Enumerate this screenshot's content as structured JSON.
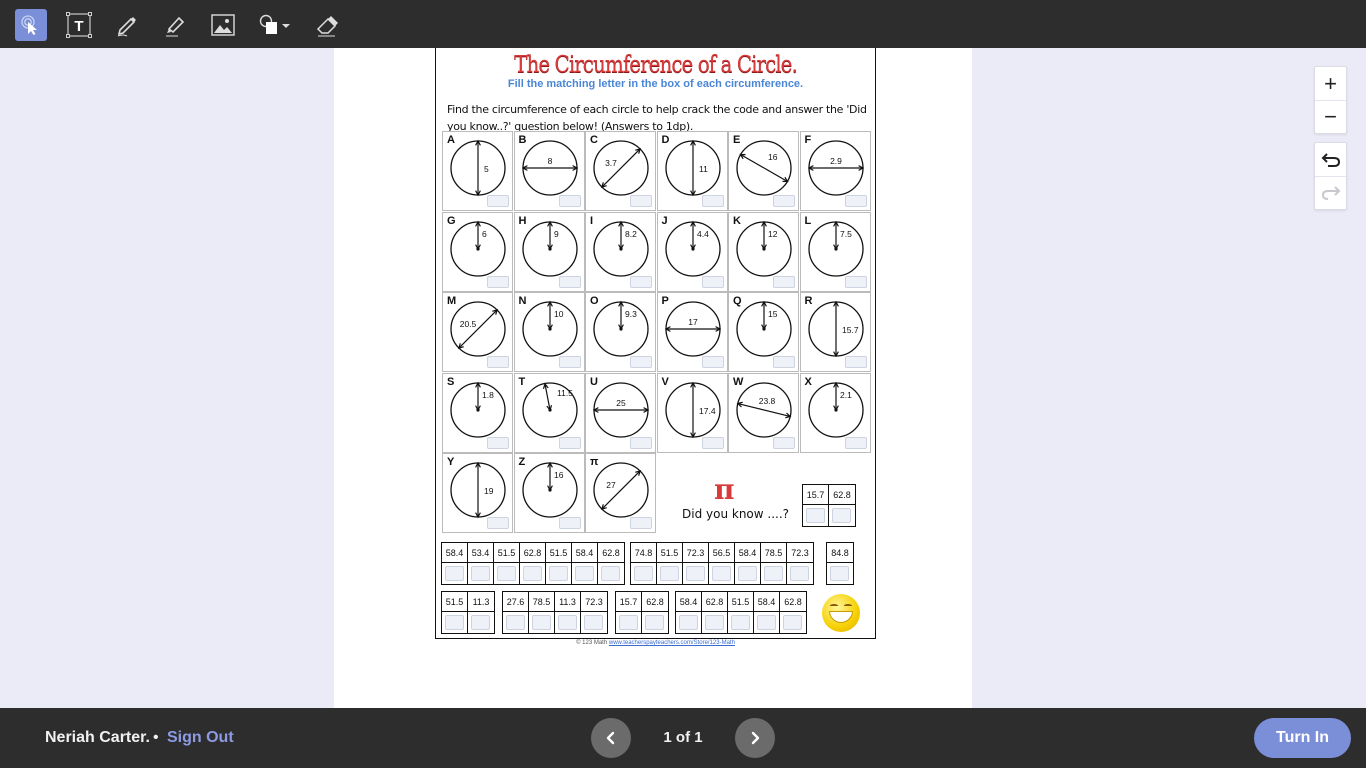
{
  "toolbar": {
    "tools": [
      {
        "name": "select-tool",
        "icon": "pointer-click-icon",
        "active": true
      },
      {
        "name": "text-tool",
        "icon": "text-box-icon",
        "glyph": "T",
        "active": false
      },
      {
        "name": "pen-tool",
        "icon": "pen-icon",
        "active": false
      },
      {
        "name": "highlighter-tool",
        "icon": "highlighter-icon",
        "active": false
      },
      {
        "name": "image-tool",
        "icon": "image-icon",
        "active": false
      },
      {
        "name": "shape-tool",
        "icon": "shapes-icon",
        "active": false
      },
      {
        "name": "eraser-tool",
        "icon": "eraser-icon",
        "active": false
      }
    ],
    "accent": "#7b8fd9"
  },
  "worksheet": {
    "title": "The Circumference of a Circle.",
    "subtitle": "Fill the matching letter in the box of each circumference.",
    "instructions": "Find the circumference of each circle to help crack the code and answer the 'Did you know..?' question below! (Answers to 1dp).",
    "circles": [
      {
        "letter": "A",
        "value": "5",
        "type": "diameter",
        "orient": "vertical"
      },
      {
        "letter": "B",
        "value": "8",
        "type": "diameter",
        "orient": "horizontal"
      },
      {
        "letter": "C",
        "value": "3.7",
        "type": "diameter",
        "orient": "diag-up"
      },
      {
        "letter": "D",
        "value": "11",
        "type": "diameter",
        "orient": "vertical"
      },
      {
        "letter": "E",
        "value": "16",
        "type": "diameter",
        "orient": "diag-down"
      },
      {
        "letter": "F",
        "value": "2.9",
        "type": "diameter",
        "orient": "horizontal"
      },
      {
        "letter": "G",
        "value": "6",
        "type": "radius",
        "orient": "up"
      },
      {
        "letter": "H",
        "value": "9",
        "type": "radius",
        "orient": "up"
      },
      {
        "letter": "I",
        "value": "8.2",
        "type": "radius",
        "orient": "up"
      },
      {
        "letter": "J",
        "value": "4.4",
        "type": "radius",
        "orient": "up"
      },
      {
        "letter": "K",
        "value": "12",
        "type": "radius",
        "orient": "up"
      },
      {
        "letter": "L",
        "value": "7.5",
        "type": "radius",
        "orient": "up"
      },
      {
        "letter": "M",
        "value": "20.5",
        "type": "diameter",
        "orient": "diag-up"
      },
      {
        "letter": "N",
        "value": "10",
        "type": "radius",
        "orient": "up"
      },
      {
        "letter": "O",
        "value": "9.3",
        "type": "radius",
        "orient": "up"
      },
      {
        "letter": "P",
        "value": "17",
        "type": "diameter",
        "orient": "horizontal"
      },
      {
        "letter": "Q",
        "value": "15",
        "type": "radius",
        "orient": "up"
      },
      {
        "letter": "R",
        "value": "15.7",
        "type": "diameter",
        "orient": "vertical"
      },
      {
        "letter": "S",
        "value": "1.8",
        "type": "radius",
        "orient": "up"
      },
      {
        "letter": "T",
        "value": "11.5",
        "type": "radius",
        "orient": "up-left"
      },
      {
        "letter": "U",
        "value": "25",
        "type": "diameter",
        "orient": "horizontal"
      },
      {
        "letter": "V",
        "value": "17.4",
        "type": "diameter",
        "orient": "vertical"
      },
      {
        "letter": "W",
        "value": "23.8",
        "type": "diameter",
        "orient": "slight-down"
      },
      {
        "letter": "X",
        "value": "2.1",
        "type": "radius",
        "orient": "up"
      },
      {
        "letter": "Y",
        "value": "19",
        "type": "diameter",
        "orient": "vertical"
      },
      {
        "letter": "Z",
        "value": "16",
        "type": "radius",
        "orient": "up"
      },
      {
        "letter": "π",
        "value": "27",
        "type": "diameter",
        "orient": "diag-up"
      }
    ],
    "pi_symbol": "π",
    "did_you_know": "Did you know ....?",
    "code_groups_row1": [
      [
        "15.7",
        "62.8"
      ]
    ],
    "code_groups_row2": [
      [
        "58.4",
        "53.4",
        "51.5",
        "62.8",
        "51.5",
        "58.4",
        "62.8"
      ],
      [
        "74.8",
        "51.5",
        "72.3",
        "56.5",
        "58.4",
        "78.5",
        "72.3"
      ],
      [
        "84.8"
      ]
    ],
    "code_groups_row3": [
      [
        "51.5",
        "11.3"
      ],
      [
        "27.6",
        "78.5",
        "11.3",
        "72.3"
      ],
      [
        "15.7",
        "62.8"
      ],
      [
        "58.4",
        "62.8",
        "51.5",
        "58.4",
        "62.8"
      ]
    ],
    "credit_prefix": "© 123 Math",
    "credit_link": "www.teacherspayteachers.com/Store/123-Math"
  },
  "zoom_controls": {
    "zoom_in": "+",
    "zoom_out": "−",
    "undo": "↶",
    "redo": "↷"
  },
  "bottombar": {
    "user_name": "Neriah Carter.",
    "separator": "•",
    "sign_out": "Sign Out",
    "page_indicator": "1 of 1",
    "turn_in": "Turn In"
  }
}
